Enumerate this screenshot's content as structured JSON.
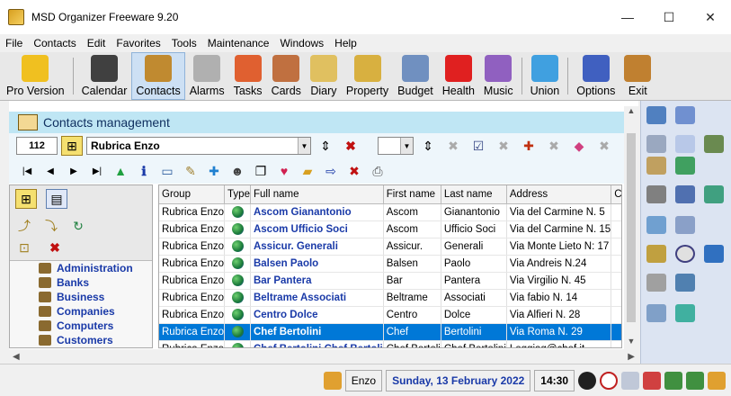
{
  "window": {
    "title": "MSD Organizer Freeware 9.20",
    "controls": [
      "—",
      "☐",
      "✕"
    ]
  },
  "menu": [
    "File",
    "Contacts",
    "Edit",
    "Favorites",
    "Tools",
    "Maintenance",
    "Windows",
    "Help"
  ],
  "toolbar": [
    {
      "label": "Pro Version",
      "icon": "pro-version-icon",
      "color": "#f0c020"
    },
    {
      "label": "Calendar",
      "icon": "calendar-icon",
      "color": "#404040"
    },
    {
      "label": "Contacts",
      "icon": "contacts-book-icon",
      "color": "#c08a30"
    },
    {
      "label": "Alarms",
      "icon": "alarm-clock-icon",
      "color": "#b0b0b0"
    },
    {
      "label": "Tasks",
      "icon": "tasks-clipboard-icon",
      "color": "#e06030"
    },
    {
      "label": "Cards",
      "icon": "cards-icon",
      "color": "#c07040"
    },
    {
      "label": "Diary",
      "icon": "diary-icon",
      "color": "#e0c060"
    },
    {
      "label": "Property",
      "icon": "house-icon",
      "color": "#d8b040"
    },
    {
      "label": "Budget",
      "icon": "calculator-icon",
      "color": "#7090c0"
    },
    {
      "label": "Health",
      "icon": "red-cross-icon",
      "color": "#e02020"
    },
    {
      "label": "Music",
      "icon": "music-cd-icon",
      "color": "#9060c0"
    },
    {
      "label": "Union",
      "icon": "puzzle-icon",
      "color": "#40a0e0"
    },
    {
      "label": "Options",
      "icon": "gears-icon",
      "color": "#4060c0"
    },
    {
      "label": "Exit",
      "icon": "exit-door-icon",
      "color": "#c08030"
    }
  ],
  "panel": {
    "title": "Contacts management"
  },
  "controls": {
    "record_number": "112",
    "group_value": "Rubrica Enzo"
  },
  "categories": [
    "Administration",
    "Banks",
    "Business",
    "Companies",
    "Computers",
    "Customers"
  ],
  "grid": {
    "columns": [
      "Group",
      "Type",
      "Full name",
      "First name",
      "Last name",
      "Address",
      "C"
    ],
    "rows": [
      {
        "group": "Rubrica Enzo",
        "full": "Ascom Gianantonio",
        "first": "Ascom",
        "last": "Gianantonio",
        "address": "Via del Carmine N. 5"
      },
      {
        "group": "Rubrica Enzo",
        "full": "Ascom Ufficio Soci",
        "first": "Ascom",
        "last": "Ufficio Soci",
        "address": "Via del Carmine N. 15"
      },
      {
        "group": "Rubrica Enzo",
        "full": "Assicur. Generali",
        "first": "Assicur.",
        "last": "Generali",
        "address": "Via Monte Lieto N: 17"
      },
      {
        "group": "Rubrica Enzo",
        "full": "Balsen Paolo",
        "first": "Balsen",
        "last": "Paolo",
        "address": "Via Andreis N.24"
      },
      {
        "group": "Rubrica Enzo",
        "full": "Bar Pantera",
        "first": "Bar",
        "last": "Pantera",
        "address": "Via Virgilio N. 45"
      },
      {
        "group": "Rubrica Enzo",
        "full": "Beltrame Associati",
        "first": "Beltrame",
        "last": "Associati",
        "address": "Via fabio N. 14"
      },
      {
        "group": "Rubrica Enzo",
        "full": "Centro Dolce",
        "first": "Centro",
        "last": "Dolce",
        "address": "Via Alfieri N. 28"
      },
      {
        "group": "Rubrica Enzo",
        "full": "Chef Bertolini",
        "first": "Chef",
        "last": "Bertolini",
        "address": "Via Roma N. 29",
        "selected": true
      },
      {
        "group": "Rubrica Enzo",
        "full": "Chef Bertolini Chef Bertoli",
        "first": "Chef Bertoli",
        "last": "Chef Bertolini",
        "address": "Loggiag@chef.it"
      }
    ]
  },
  "status": {
    "user": "Enzo",
    "date": "Sunday, 13 February 2022",
    "time": "14:30"
  }
}
